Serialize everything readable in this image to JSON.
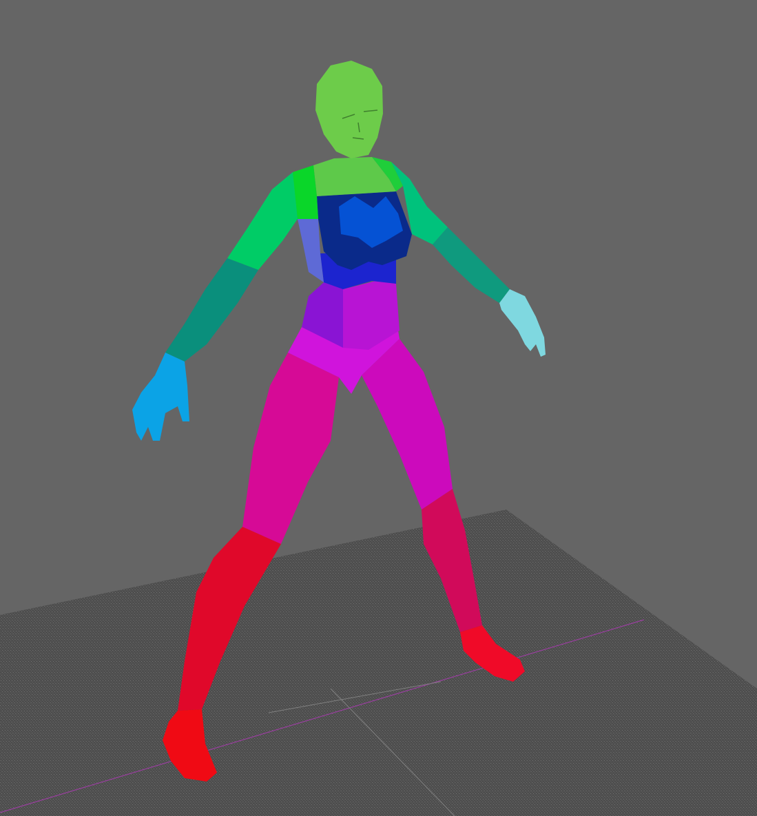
{
  "viewport": {
    "view": "perspective",
    "background_color": "#656565",
    "grid_color": "#7a7a7a",
    "floor_color": "#4a4a4a",
    "axis_color": "#9a3fa0"
  },
  "figure": {
    "icon": "humanoid-figure-icon",
    "segments": [
      {
        "name": "head",
        "color": "#6dcc4a"
      },
      {
        "name": "neck",
        "color": "#5ec94a"
      },
      {
        "name": "shoulder-left",
        "color": "#0ad629"
      },
      {
        "name": "shoulder-right",
        "color": "#1fce3a"
      },
      {
        "name": "upper-arm-left",
        "color": "#00cc66"
      },
      {
        "name": "upper-arm-right",
        "color": "#00c27c"
      },
      {
        "name": "forearm-left",
        "color": "#0a8f7c"
      },
      {
        "name": "forearm-right",
        "color": "#0f9a7e"
      },
      {
        "name": "hand-left",
        "color": "#0ba3e6"
      },
      {
        "name": "hand-right",
        "color": "#7fd8e0"
      },
      {
        "name": "chest",
        "color": "#0a2a8a"
      },
      {
        "name": "chest-center",
        "color": "#0552d4"
      },
      {
        "name": "side-torso",
        "color": "#5e6ad6"
      },
      {
        "name": "ribs",
        "color": "#1c24cf"
      },
      {
        "name": "waist",
        "color": "#8a14d4"
      },
      {
        "name": "abdomen",
        "color": "#b814d4"
      },
      {
        "name": "pelvis",
        "color": "#d014dc"
      },
      {
        "name": "thigh-left",
        "color": "#d60a96"
      },
      {
        "name": "thigh-right",
        "color": "#cc0abc"
      },
      {
        "name": "shin-left",
        "color": "#e0082a"
      },
      {
        "name": "shin-right",
        "color": "#d10a5a"
      },
      {
        "name": "foot-left",
        "color": "#f00a14"
      },
      {
        "name": "foot-right",
        "color": "#f00a28"
      }
    ]
  }
}
